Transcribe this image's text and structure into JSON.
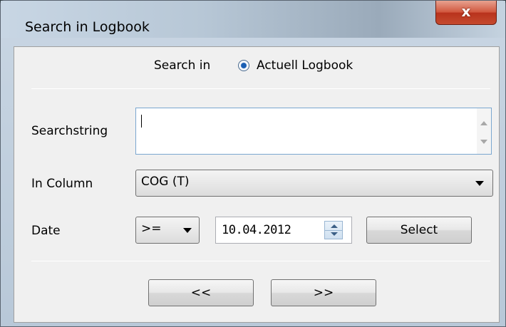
{
  "window": {
    "title": "Search in Logbook",
    "close_glyph": "x"
  },
  "search_in": {
    "label": "Search in",
    "option_label": "Actuell Logbook",
    "selected": true
  },
  "searchstring": {
    "label": "Searchstring",
    "value": ""
  },
  "in_column": {
    "label": "In Column",
    "selected": "COG (T)"
  },
  "date": {
    "label": "Date",
    "operator": ">=",
    "value": "10.04.2012",
    "select_label": "Select"
  },
  "nav": {
    "prev_label": "<<",
    "next_label": ">>"
  },
  "icons": {
    "close": "close-icon",
    "dropdown": "chevron-down-icon",
    "spin": "spin-arrows-icon"
  },
  "colors": {
    "close_button": "#c54a2e",
    "radio_dot": "#1a5fb4",
    "focus_border": "#7aa7d0"
  }
}
